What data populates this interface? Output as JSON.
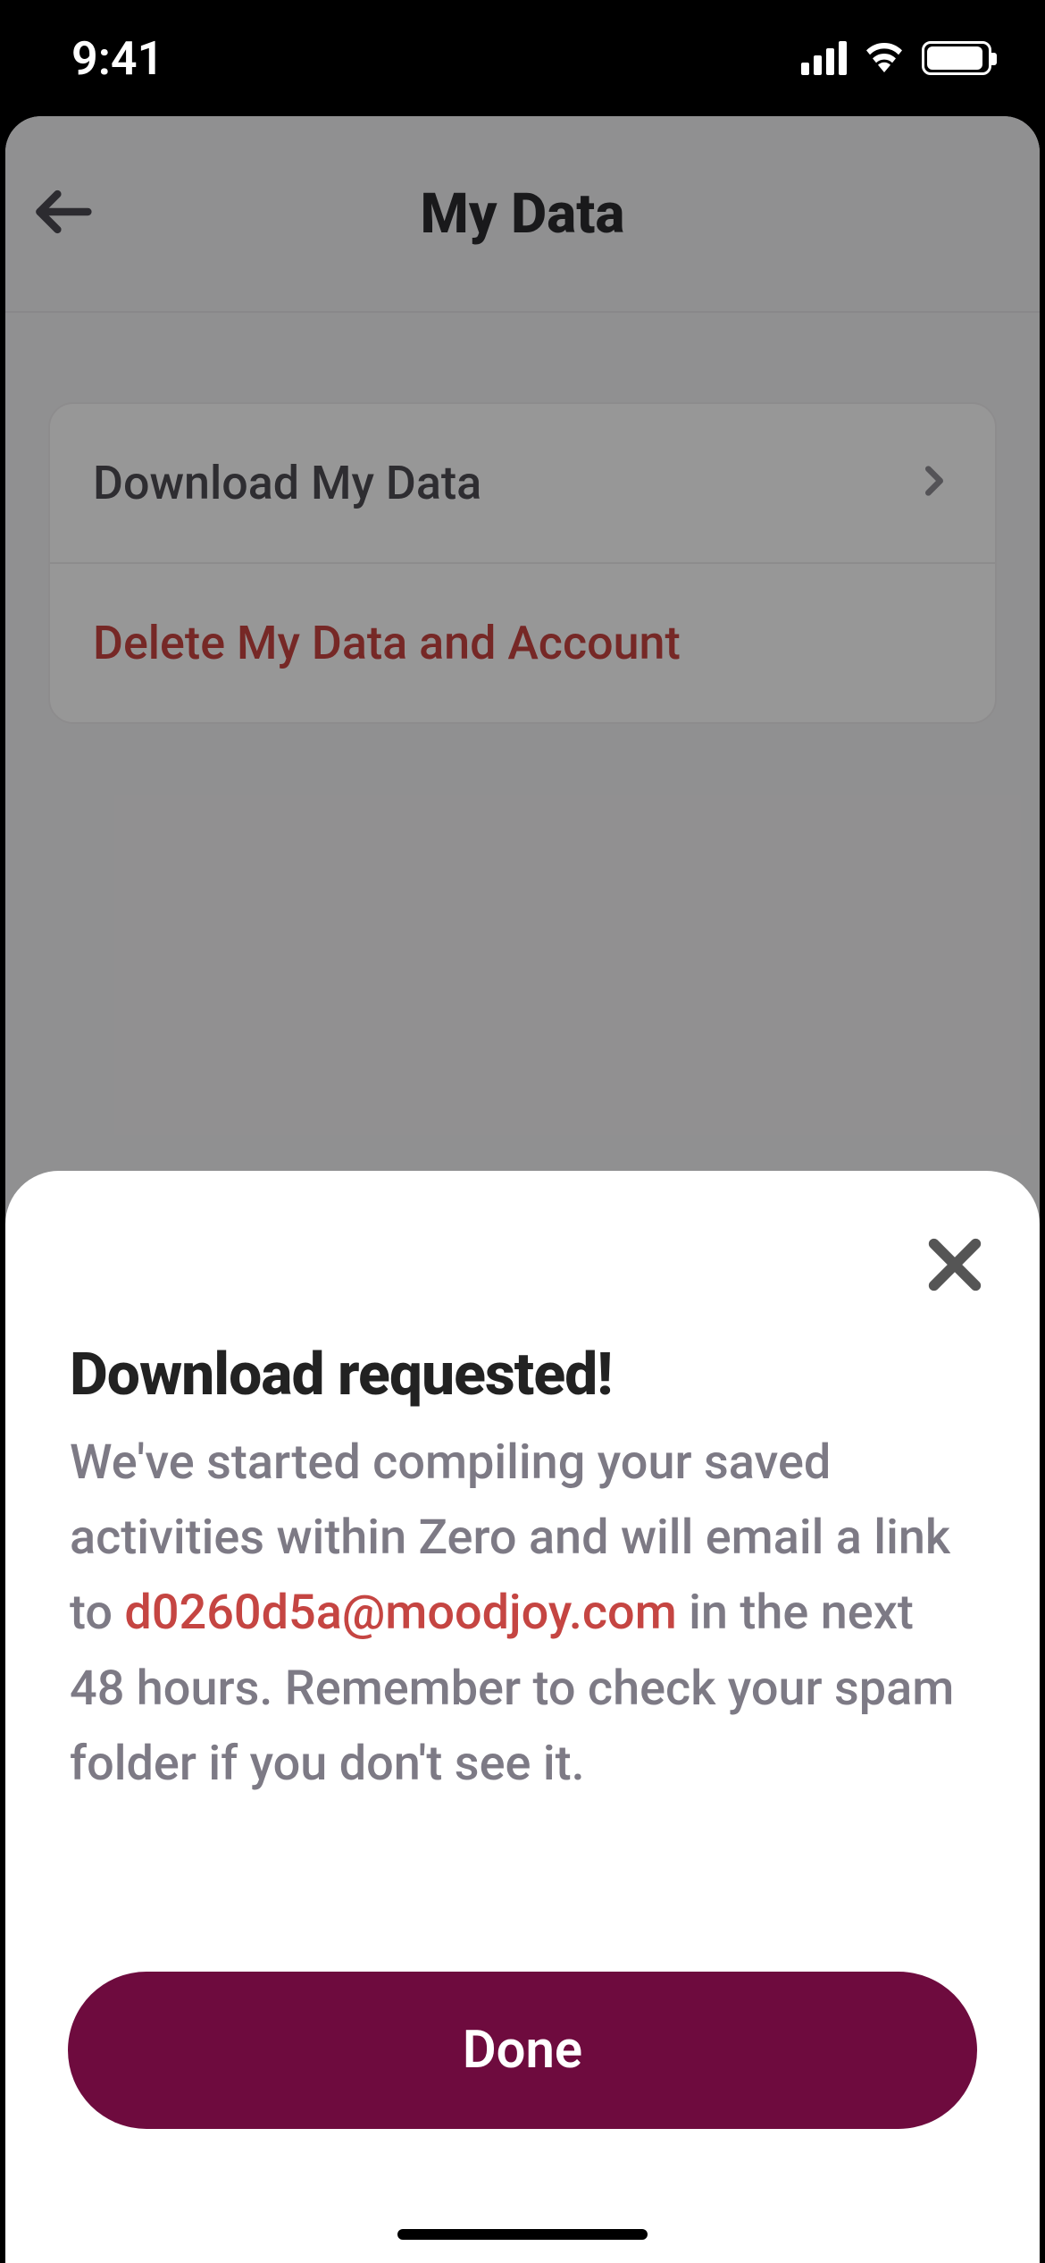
{
  "status_bar": {
    "time": "9:41"
  },
  "page": {
    "title": "My Data",
    "rows": {
      "download": "Download My Data",
      "delete": "Delete My Data and Account"
    }
  },
  "sheet": {
    "title": "Download requested!",
    "body_pre": "We've started compiling your saved activities within Zero and will email a link to ",
    "email": "d0260d5a@moodjoy.com",
    "body_post": " in the next 48 hours. Remember to check your spam folder if you don't see it.",
    "done": "Done"
  }
}
